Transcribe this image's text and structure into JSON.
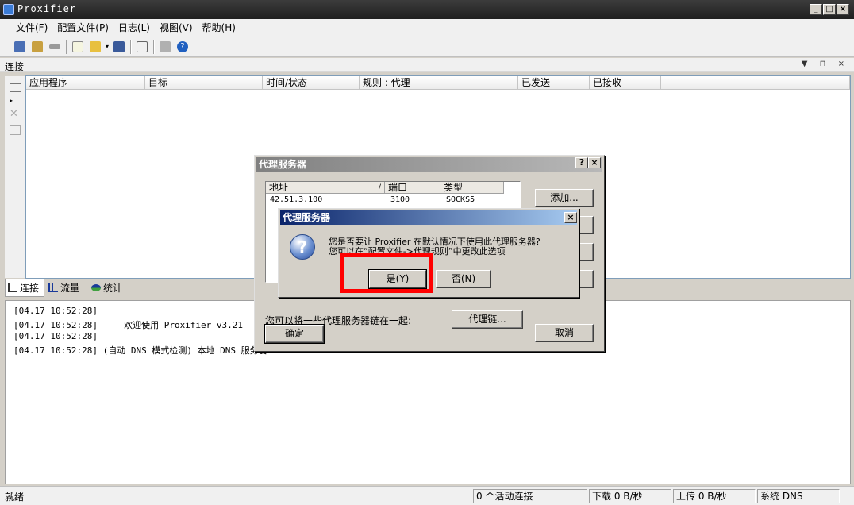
{
  "window": {
    "title": "Proxifier",
    "controls": [
      "_",
      "□",
      "×"
    ]
  },
  "menu": [
    "文件(F)",
    "配置文件(P)",
    "日志(L)",
    "视图(V)",
    "帮助(H)"
  ],
  "toolbar_icons": [
    "connections-icon",
    "profile-icon",
    "key-icon",
    "new-profile-icon",
    "open-profile-icon",
    "save-icon",
    "export-icon",
    "print-icon",
    "help-icon"
  ],
  "connections_pane": {
    "title": "连接",
    "controls": "▼ ⊓ ×",
    "columns": [
      "应用程序",
      "目标",
      "时间/状态",
      "规则 : 代理",
      "已发送",
      "已接收"
    ]
  },
  "bottom_tabs": [
    {
      "label": "连接",
      "icon": "connections-tab-icon"
    },
    {
      "label": "流量",
      "icon": "traffic-tab-icon"
    },
    {
      "label": "统计",
      "icon": "stats-tab-icon"
    }
  ],
  "log": [
    "[04.17 10:52:28]",
    "[04.17 10:52:28]     欢迎使用 Proxifier v3.21",
    "[04.17 10:52:28]",
    "[04.17 10:52:28] (自动 DNS 模式检测) 本地 DNS 服务器"
  ],
  "status_bar": {
    "ready": "就绪",
    "active": "0 个活动连接",
    "down": "下载 0 B/秒",
    "up": "上传 0 B/秒",
    "dns": "系统 DNS"
  },
  "proxy_dialog": {
    "title": "代理服务器",
    "help_btn": "?",
    "close_btn": "×",
    "columns": {
      "address": "地址",
      "sort": "/",
      "port": "端口",
      "type": "类型"
    },
    "rows": [
      {
        "address": "42.51.3.100",
        "port": "3100",
        "type": "SOCKS5"
      }
    ],
    "add_button": "添加...",
    "chain_text": "您可以将一些代理服务器链在一起:",
    "chain_button": "代理链...",
    "ok_button": "确定",
    "cancel_button": "取消"
  },
  "confirm_dialog": {
    "title": "代理服务器",
    "close_btn": "×",
    "line1": "您是否要让 Proxifier 在默认情况下使用此代理服务器?",
    "line2": "您可以在“配置文件->代理规则”中更改此选项",
    "yes_button": "是(Y)",
    "no_button": "否(N)",
    "icon": "question-icon"
  },
  "highlight_color": "#ff0000"
}
